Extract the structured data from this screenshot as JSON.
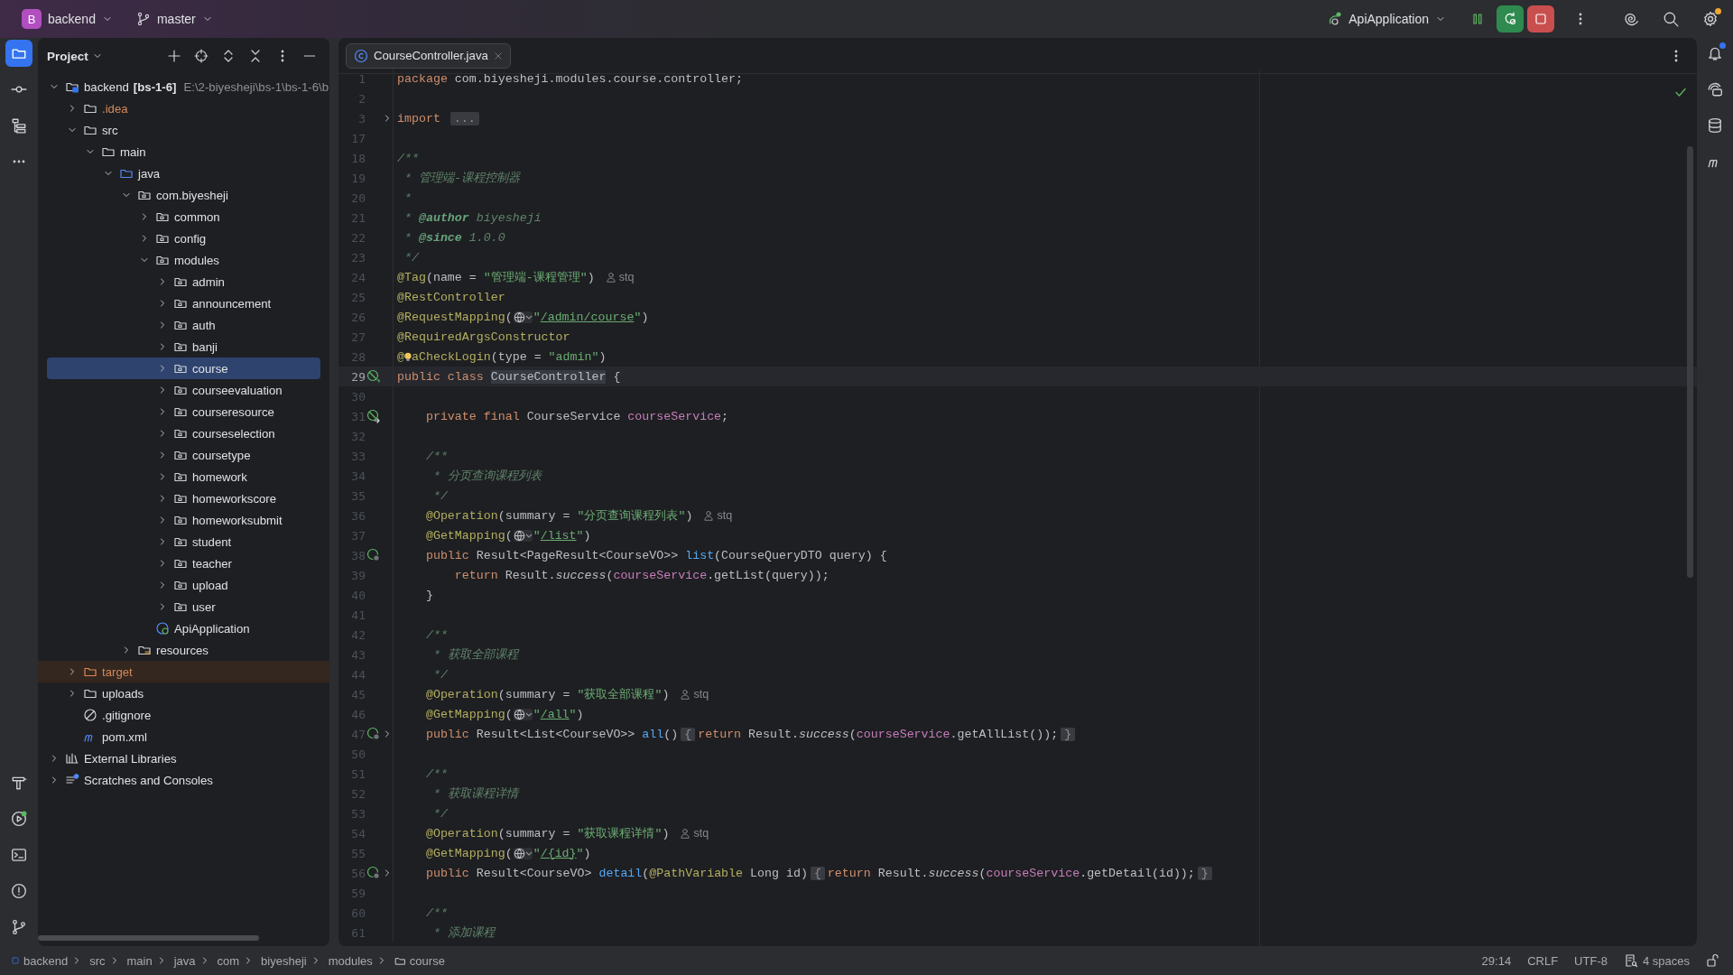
{
  "titlebar": {
    "project_badge": "B",
    "project": "backend",
    "branch": "master",
    "run_config": "ApiApplication"
  },
  "project_panel": {
    "title": "Project",
    "tree": [
      {
        "label": "backend",
        "tag": "[bs-1-6]",
        "path": "E:\\2-biyesheji\\bs-1\\bs-1-6\\b",
        "kind": "module",
        "expanded": true,
        "selected": false,
        "children": [
          {
            "label": ".idea",
            "kind": "ignored",
            "expanded": false,
            "selected": false
          },
          {
            "label": "src",
            "kind": "folder",
            "expanded": true,
            "selected": false,
            "children": [
              {
                "label": "main",
                "kind": "folder",
                "expanded": true,
                "selected": false,
                "children": [
                  {
                    "label": "java",
                    "kind": "source",
                    "expanded": true,
                    "selected": false,
                    "children": [
                      {
                        "label": "com.biyesheji",
                        "kind": "package",
                        "expanded": true,
                        "selected": false,
                        "children": [
                          {
                            "label": "common",
                            "kind": "package",
                            "expanded": false,
                            "selected": false
                          },
                          {
                            "label": "config",
                            "kind": "package",
                            "expanded": false,
                            "selected": false
                          },
                          {
                            "label": "modules",
                            "kind": "package",
                            "expanded": true,
                            "selected": false,
                            "children": [
                              {
                                "label": "admin",
                                "kind": "package",
                                "expanded": false,
                                "selected": false
                              },
                              {
                                "label": "announcement",
                                "kind": "package",
                                "expanded": false,
                                "selected": false
                              },
                              {
                                "label": "auth",
                                "kind": "package",
                                "expanded": false,
                                "selected": false
                              },
                              {
                                "label": "banji",
                                "kind": "package",
                                "expanded": false,
                                "selected": false
                              },
                              {
                                "label": "course",
                                "kind": "package",
                                "expanded": false,
                                "selected": true
                              },
                              {
                                "label": "courseevaluation",
                                "kind": "package",
                                "expanded": false,
                                "selected": false
                              },
                              {
                                "label": "courseresource",
                                "kind": "package",
                                "expanded": false,
                                "selected": false
                              },
                              {
                                "label": "courseselection",
                                "kind": "package",
                                "expanded": false,
                                "selected": false
                              },
                              {
                                "label": "coursetype",
                                "kind": "package",
                                "expanded": false,
                                "selected": false
                              },
                              {
                                "label": "homework",
                                "kind": "package",
                                "expanded": false,
                                "selected": false
                              },
                              {
                                "label": "homeworkscore",
                                "kind": "package",
                                "expanded": false,
                                "selected": false
                              },
                              {
                                "label": "homeworksubmit",
                                "kind": "package",
                                "expanded": false,
                                "selected": false
                              },
                              {
                                "label": "student",
                                "kind": "package",
                                "expanded": false,
                                "selected": false
                              },
                              {
                                "label": "teacher",
                                "kind": "package",
                                "expanded": false,
                                "selected": false
                              },
                              {
                                "label": "upload",
                                "kind": "package",
                                "expanded": false,
                                "selected": false
                              },
                              {
                                "label": "user",
                                "kind": "package",
                                "expanded": false,
                                "selected": false
                              }
                            ]
                          },
                          {
                            "label": "ApiApplication",
                            "kind": "app",
                            "selected": false
                          }
                        ]
                      },
                      {
                        "label": "resources",
                        "kind": "resources",
                        "expanded": false,
                        "selected": false
                      }
                    ]
                  }
                ]
              }
            ]
          },
          {
            "label": "target",
            "kind": "excluded",
            "expanded": false,
            "selected": false
          },
          {
            "label": "uploads",
            "kind": "folder",
            "expanded": false,
            "selected": false
          },
          {
            "label": ".gitignore",
            "kind": "gitignore",
            "selected": false
          },
          {
            "label": "pom.xml",
            "kind": "maven",
            "selected": false
          }
        ]
      },
      {
        "label": "External Libraries",
        "kind": "libraries",
        "expanded": false,
        "selected": false
      },
      {
        "label": "Scratches and Consoles",
        "kind": "scratches",
        "expanded": false,
        "selected": false
      }
    ]
  },
  "editor": {
    "tab": {
      "label": "CourseController.java",
      "selected": true
    },
    "lines": [
      {
        "no": "1",
        "tokens": [
          {
            "text": "package ",
            "kind": "kw"
          },
          {
            "text": "com.biyesheji.modules.course.controller;",
            "kind": "plain"
          }
        ]
      },
      {
        "no": "2"
      },
      {
        "no": "3",
        "folded": true,
        "tokens": [
          {
            "text": "import ",
            "kind": "kw"
          },
          {
            "text": "...",
            "kind": "fold"
          }
        ]
      },
      {
        "no": "17"
      },
      {
        "no": "18",
        "tokens": [
          {
            "text": "/**",
            "kind": "doc"
          }
        ]
      },
      {
        "no": "19",
        "tokens": [
          {
            "text": " * 管理端-课程控制器",
            "kind": "doc"
          }
        ]
      },
      {
        "no": "20",
        "tokens": [
          {
            "text": " *",
            "kind": "doc"
          }
        ]
      },
      {
        "no": "21",
        "tokens": [
          {
            "text": " * ",
            "kind": "doc"
          },
          {
            "text": "@author",
            "kind": "doctag"
          },
          {
            "text": " biyesheji",
            "kind": "doc"
          }
        ]
      },
      {
        "no": "22",
        "tokens": [
          {
            "text": " * ",
            "kind": "doc"
          },
          {
            "text": "@since",
            "kind": "doctag"
          },
          {
            "text": " 1.0.0",
            "kind": "doc"
          }
        ]
      },
      {
        "no": "23",
        "tokens": [
          {
            "text": " */",
            "kind": "doc"
          }
        ]
      },
      {
        "no": "24",
        "tokens": [
          {
            "text": "@Tag",
            "kind": "annot"
          },
          {
            "text": "(name = ",
            "kind": "plain"
          },
          {
            "text": "\"管理端-课程管理\"",
            "kind": "str"
          },
          {
            "text": ")",
            "kind": "plain"
          },
          {
            "text": "stq",
            "kind": "author"
          }
        ]
      },
      {
        "no": "25",
        "tokens": [
          {
            "text": "@RestController",
            "kind": "annot"
          }
        ]
      },
      {
        "no": "26",
        "tokens": [
          {
            "text": "@RequestMapping",
            "kind": "annot"
          },
          {
            "text": "(",
            "kind": "plain"
          },
          {
            "kind": "globe"
          },
          {
            "text": "\"",
            "kind": "str"
          },
          {
            "text": "/admin/course",
            "kind": "url"
          },
          {
            "text": "\"",
            "kind": "str"
          },
          {
            "text": ")",
            "kind": "plain"
          }
        ]
      },
      {
        "no": "27",
        "tokens": [
          {
            "text": "@RequiredArgsConstructor",
            "kind": "annot"
          }
        ]
      },
      {
        "no": "28",
        "tokens": [
          {
            "text": "@",
            "kind": "annot"
          },
          {
            "kind": "bulb"
          },
          {
            "text": "aCheckLogin",
            "kind": "annot"
          },
          {
            "text": "(type = ",
            "kind": "plain"
          },
          {
            "text": "\"admin\"",
            "kind": "str"
          },
          {
            "text": ")",
            "kind": "plain"
          }
        ]
      },
      {
        "no": "29",
        "current": true,
        "kind": "bean",
        "tokens": [
          {
            "text": "public class ",
            "kind": "kw"
          },
          {
            "text": "CourseController",
            "kind": "hl"
          },
          {
            "text": " {",
            "kind": "plain"
          }
        ]
      },
      {
        "no": "30"
      },
      {
        "no": "31",
        "kind": "inject",
        "tokens": [
          {
            "text": "    private final ",
            "kind": "kw"
          },
          {
            "text": "CourseService ",
            "kind": "plain"
          },
          {
            "text": "courseService",
            "kind": "field"
          },
          {
            "text": ";",
            "kind": "plain"
          }
        ]
      },
      {
        "no": "32"
      },
      {
        "no": "33",
        "tokens": [
          {
            "text": "    /**",
            "kind": "doc"
          }
        ]
      },
      {
        "no": "34",
        "tokens": [
          {
            "text": "     * 分页查询课程列表",
            "kind": "doc"
          }
        ]
      },
      {
        "no": "35",
        "tokens": [
          {
            "text": "     */",
            "kind": "doc"
          }
        ]
      },
      {
        "no": "36",
        "tokens": [
          {
            "text": "    @Operation",
            "kind": "annot"
          },
          {
            "text": "(summary = ",
            "kind": "plain"
          },
          {
            "text": "\"分页查询课程列表\"",
            "kind": "str"
          },
          {
            "text": ")",
            "kind": "plain"
          },
          {
            "text": "stq",
            "kind": "author"
          }
        ]
      },
      {
        "no": "37",
        "tokens": [
          {
            "text": "    @GetMapping",
            "kind": "annot"
          },
          {
            "text": "(",
            "kind": "plain"
          },
          {
            "kind": "globe"
          },
          {
            "text": "\"",
            "kind": "str"
          },
          {
            "text": "/list",
            "kind": "url"
          },
          {
            "text": "\"",
            "kind": "str"
          },
          {
            "text": ")",
            "kind": "plain"
          }
        ]
      },
      {
        "no": "38",
        "kind": "web",
        "tokens": [
          {
            "text": "    public ",
            "kind": "kw"
          },
          {
            "text": "Result<PageResult<CourseVO>> ",
            "kind": "plain"
          },
          {
            "text": "list",
            "kind": "method"
          },
          {
            "text": "(CourseQueryDTO query) {",
            "kind": "plain"
          }
        ]
      },
      {
        "no": "39",
        "tokens": [
          {
            "text": "        return ",
            "kind": "kw"
          },
          {
            "text": "Result.",
            "kind": "plain"
          },
          {
            "text": "success",
            "kind": "static"
          },
          {
            "text": "(",
            "kind": "plain"
          },
          {
            "text": "courseService",
            "kind": "field"
          },
          {
            "text": ".getList(query));",
            "kind": "plain"
          }
        ]
      },
      {
        "no": "40",
        "tokens": [
          {
            "text": "    }",
            "kind": "plain"
          }
        ]
      },
      {
        "no": "41"
      },
      {
        "no": "42",
        "tokens": [
          {
            "text": "    /**",
            "kind": "doc"
          }
        ]
      },
      {
        "no": "43",
        "tokens": [
          {
            "text": "     * 获取全部课程",
            "kind": "doc"
          }
        ]
      },
      {
        "no": "44",
        "tokens": [
          {
            "text": "     */",
            "kind": "doc"
          }
        ]
      },
      {
        "no": "45",
        "tokens": [
          {
            "text": "    @Operation",
            "kind": "annot"
          },
          {
            "text": "(summary = ",
            "kind": "plain"
          },
          {
            "text": "\"获取全部课程\"",
            "kind": "str"
          },
          {
            "text": ")",
            "kind": "plain"
          },
          {
            "text": "stq",
            "kind": "author"
          }
        ]
      },
      {
        "no": "46",
        "tokens": [
          {
            "text": "    @GetMapping",
            "kind": "annot"
          },
          {
            "text": "(",
            "kind": "plain"
          },
          {
            "kind": "globe"
          },
          {
            "text": "\"",
            "kind": "str"
          },
          {
            "text": "/all",
            "kind": "url"
          },
          {
            "text": "\"",
            "kind": "str"
          },
          {
            "text": ")",
            "kind": "plain"
          }
        ]
      },
      {
        "no": "47",
        "kind": "web",
        "folded": true,
        "tokens": [
          {
            "text": "    public ",
            "kind": "kw"
          },
          {
            "text": "Result<List<CourseVO>> ",
            "kind": "plain"
          },
          {
            "text": "all",
            "kind": "method"
          },
          {
            "text": "()",
            "kind": "plain"
          },
          {
            "text": "{",
            "kind": "fold"
          },
          {
            "text": "return ",
            "kind": "kw"
          },
          {
            "text": "Result.",
            "kind": "plain"
          },
          {
            "text": "success",
            "kind": "static"
          },
          {
            "text": "(",
            "kind": "plain"
          },
          {
            "text": "courseService",
            "kind": "field"
          },
          {
            "text": ".getAllList());",
            "kind": "plain"
          },
          {
            "text": "}",
            "kind": "fold"
          }
        ]
      },
      {
        "no": "50"
      },
      {
        "no": "51",
        "tokens": [
          {
            "text": "    /**",
            "kind": "doc"
          }
        ]
      },
      {
        "no": "52",
        "tokens": [
          {
            "text": "     * 获取课程详情",
            "kind": "doc"
          }
        ]
      },
      {
        "no": "53",
        "tokens": [
          {
            "text": "     */",
            "kind": "doc"
          }
        ]
      },
      {
        "no": "54",
        "tokens": [
          {
            "text": "    @Operation",
            "kind": "annot"
          },
          {
            "text": "(summary = ",
            "kind": "plain"
          },
          {
            "text": "\"获取课程详情\"",
            "kind": "str"
          },
          {
            "text": ")",
            "kind": "plain"
          },
          {
            "text": "stq",
            "kind": "author"
          }
        ]
      },
      {
        "no": "55",
        "tokens": [
          {
            "text": "    @GetMapping",
            "kind": "annot"
          },
          {
            "text": "(",
            "kind": "plain"
          },
          {
            "kind": "globe"
          },
          {
            "text": "\"",
            "kind": "str"
          },
          {
            "text": "/{id}",
            "kind": "url"
          },
          {
            "text": "\"",
            "kind": "str"
          },
          {
            "text": ")",
            "kind": "plain"
          }
        ]
      },
      {
        "no": "56",
        "kind": "web",
        "folded": true,
        "tokens": [
          {
            "text": "    public ",
            "kind": "kw"
          },
          {
            "text": "Result<CourseVO> ",
            "kind": "plain"
          },
          {
            "text": "detail",
            "kind": "method"
          },
          {
            "text": "(",
            "kind": "plain"
          },
          {
            "text": "@PathVariable",
            "kind": "annot"
          },
          {
            "text": " Long id)",
            "kind": "plain"
          },
          {
            "text": "{",
            "kind": "fold"
          },
          {
            "text": "return ",
            "kind": "kw"
          },
          {
            "text": "Result.",
            "kind": "plain"
          },
          {
            "text": "success",
            "kind": "static"
          },
          {
            "text": "(",
            "kind": "plain"
          },
          {
            "text": "courseService",
            "kind": "field"
          },
          {
            "text": ".getDetail(id));",
            "kind": "plain"
          },
          {
            "text": "}",
            "kind": "fold"
          }
        ]
      },
      {
        "no": "59"
      },
      {
        "no": "60",
        "tokens": [
          {
            "text": "    /**",
            "kind": "doc"
          }
        ]
      },
      {
        "no": "61",
        "tokens": [
          {
            "text": "     * 添加课程",
            "kind": "doc"
          }
        ]
      }
    ]
  },
  "status_bar": {
    "breadcrumbs": [
      {
        "label": "backend",
        "kind": "module"
      },
      {
        "label": "src",
        "kind": "plain"
      },
      {
        "label": "main",
        "kind": "plain"
      },
      {
        "label": "java",
        "kind": "plain"
      },
      {
        "label": "com",
        "kind": "plain"
      },
      {
        "label": "biyesheji",
        "kind": "plain"
      },
      {
        "label": "modules",
        "kind": "plain"
      },
      {
        "label": "course",
        "kind": "folder"
      }
    ],
    "position": "29:14",
    "line_separator": "CRLF",
    "encoding": "UTF-8",
    "indent": "4 spaces"
  }
}
